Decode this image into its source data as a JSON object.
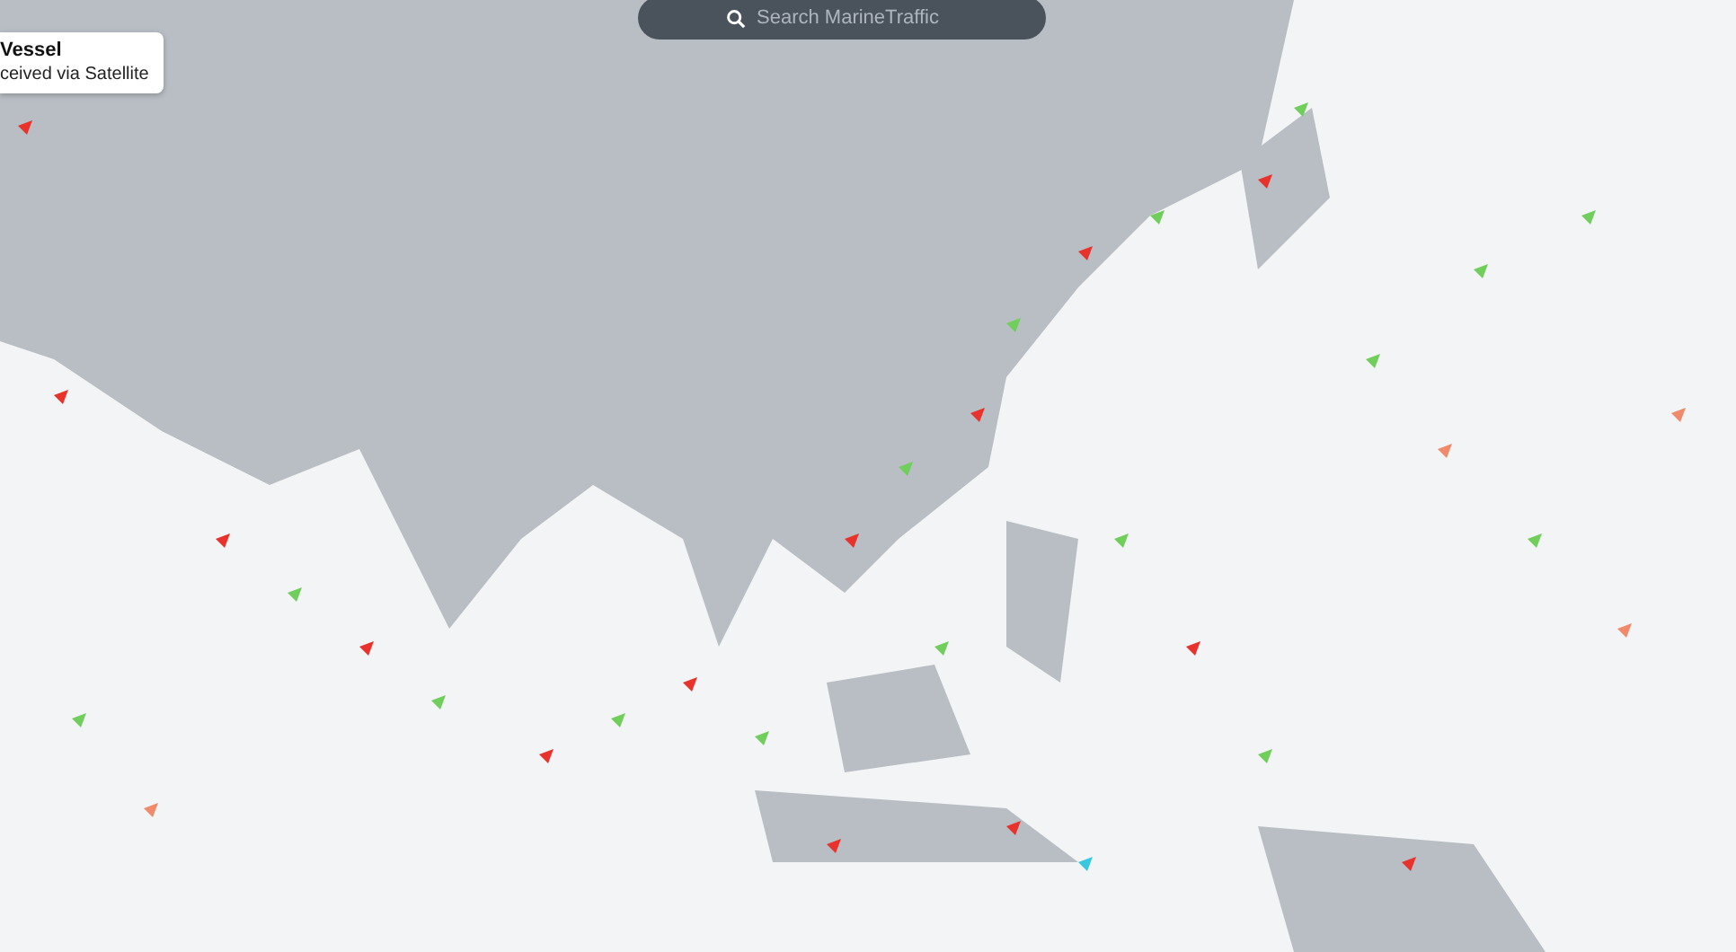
{
  "search": {
    "placeholder": "Search MarineTraffic"
  },
  "tooltip": {
    "title": "Vessel",
    "subtitle": "ceived via Satellite"
  }
}
